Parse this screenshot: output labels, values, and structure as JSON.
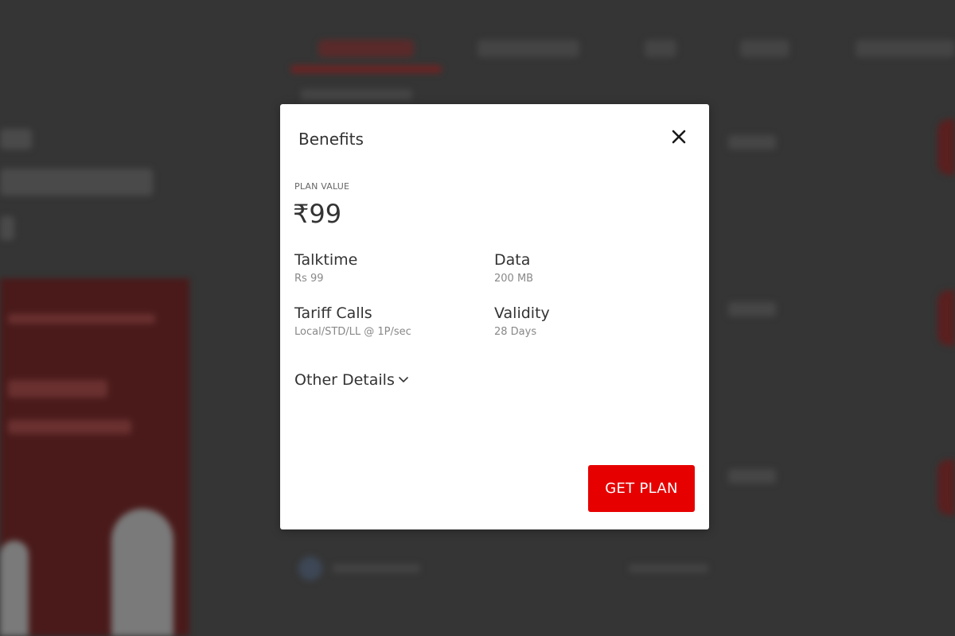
{
  "modal": {
    "title": "Benefits",
    "close_icon": "close-icon",
    "plan_value_label": "PLAN VALUE",
    "plan_value": "₹99",
    "benefits": [
      {
        "label": "Talktime",
        "value": "Rs 99"
      },
      {
        "label": "Data",
        "value": "200 MB"
      },
      {
        "label": "Tariff Calls",
        "value": "Local/STD/LL @ 1P/sec"
      },
      {
        "label": "Validity",
        "value": "28 Days"
      }
    ],
    "other_details_label": "Other Details",
    "other_details_icon": "chevron-down-icon",
    "get_plan_label": "GET PLAN"
  },
  "colors": {
    "overlay": "#353535",
    "accent": "#e60000",
    "text": "#333333",
    "muted": "#888888"
  }
}
